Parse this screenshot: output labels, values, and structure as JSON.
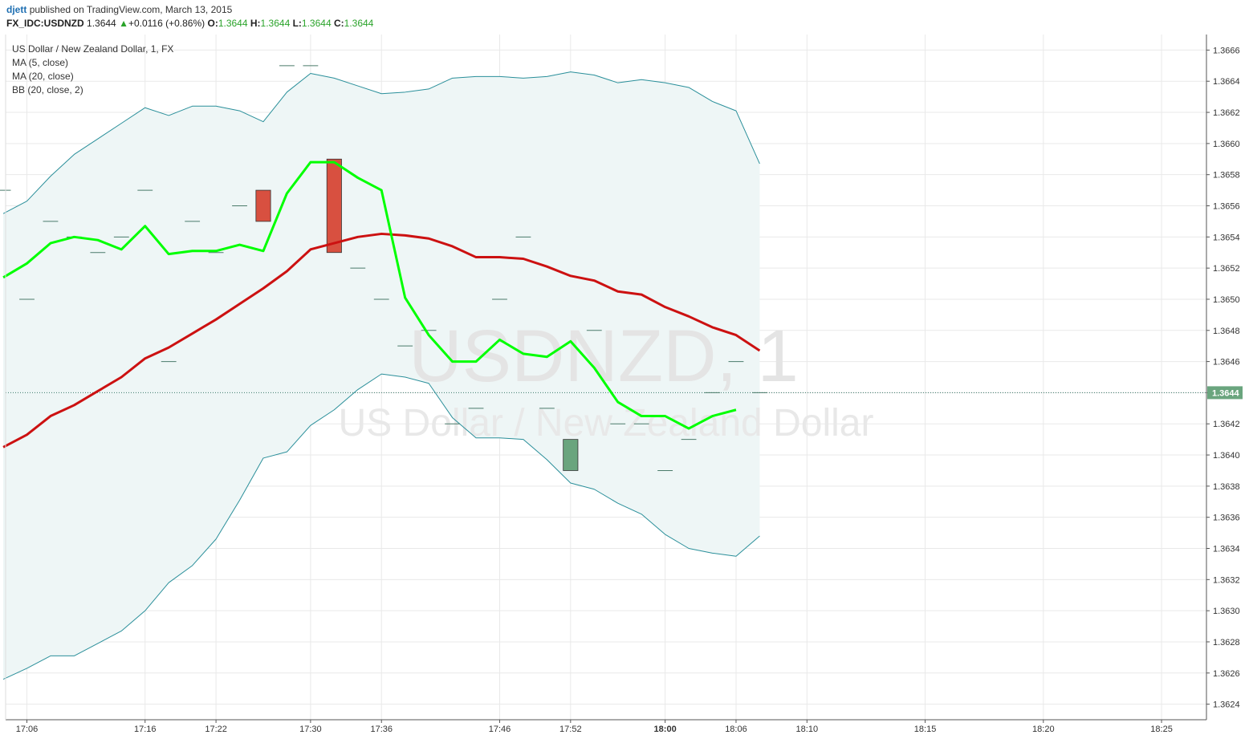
{
  "header": {
    "user": "djett",
    "published": "published on TradingView.com, March 13, 2015",
    "symbol": "FX_IDC:USDNZD",
    "last": "1.3644",
    "change_arrow": "▲",
    "change": "+0.0116 (+0.86%)",
    "o_label": "O:",
    "o_value": "1.3644",
    "h_label": "H:",
    "h_value": "1.3644",
    "l_label": "L:",
    "l_value": "1.3644",
    "c_label": "C:",
    "c_value": "1.3644"
  },
  "legend": {
    "title": "US Dollar / New Zealand Dollar, 1, FX",
    "ma5": "MA (5, close)",
    "ma20": "MA (20, close)",
    "bb": "BB (20, close, 2)"
  },
  "watermark": {
    "line1": "USDNZD, 1",
    "line2": "US Dollar / New Zealand Dollar"
  },
  "colors": {
    "ma5": "#00ff00",
    "ma20": "#cc1111",
    "bb": "#2a8f9a",
    "bb_fill": "#eef6f6",
    "up_candle": "#6aa57e",
    "down_candle": "#d85040",
    "grid": "#e9e9e9",
    "price_tag_bg": "#6aa57e"
  },
  "chart_data": {
    "type": "line",
    "price_tag": "1.3644",
    "current_price": 1.3644,
    "ylim": [
      1.3623,
      1.3667
    ],
    "y_ticks": [
      "1.3624",
      "1.3626",
      "1.3628",
      "1.3630",
      "1.3632",
      "1.3634",
      "1.3636",
      "1.3638",
      "1.3640",
      "1.3642",
      "1.3644",
      "1.3646",
      "1.3648",
      "1.3650",
      "1.3652",
      "1.3654",
      "1.3656",
      "1.3658",
      "1.3660",
      "1.3662",
      "1.3664",
      "1.3666"
    ],
    "x_ticks": [
      {
        "label": "17:06",
        "t": 0
      },
      {
        "label": "17:16",
        "t": 5
      },
      {
        "label": "17:22",
        "t": 8
      },
      {
        "label": "17:30",
        "t": 12
      },
      {
        "label": "17:36",
        "t": 15
      },
      {
        "label": "17:46",
        "t": 20
      },
      {
        "label": "17:52",
        "t": 23
      },
      {
        "label": "18:00",
        "t": 27,
        "bold": true
      },
      {
        "label": "18:06",
        "t": 30
      },
      {
        "label": "18:10",
        "t": 33
      },
      {
        "label": "18:15",
        "t": 38
      },
      {
        "label": "18:20",
        "t": 43
      },
      {
        "label": "18:25",
        "t": 48
      }
    ],
    "x_range": [
      -0.9,
      49.9
    ],
    "candles": [
      {
        "t": -1,
        "o": 1.3657,
        "c": 1.3657
      },
      {
        "t": 0,
        "o": 1.365,
        "c": 1.365
      },
      {
        "t": 1,
        "o": 1.3655,
        "c": 1.3655
      },
      {
        "t": 2,
        "o": 1.3654,
        "c": 1.3654
      },
      {
        "t": 3,
        "o": 1.3653,
        "c": 1.3653
      },
      {
        "t": 4,
        "o": 1.3654,
        "c": 1.3654
      },
      {
        "t": 5,
        "o": 1.3657,
        "c": 1.3657
      },
      {
        "t": 6,
        "o": 1.3646,
        "c": 1.3646
      },
      {
        "t": 7,
        "o": 1.3655,
        "c": 1.3655
      },
      {
        "t": 8,
        "o": 1.3653,
        "c": 1.3653
      },
      {
        "t": 9,
        "o": 1.3656,
        "c": 1.3656
      },
      {
        "t": 10,
        "o": 1.3657,
        "c": 1.3655
      },
      {
        "t": 11,
        "o": 1.3665,
        "c": 1.3665
      },
      {
        "t": 12,
        "o": 1.3665,
        "c": 1.3665
      },
      {
        "t": 13,
        "o": 1.3659,
        "c": 1.3653
      },
      {
        "t": 14,
        "o": 1.3652,
        "c": 1.3652
      },
      {
        "t": 15,
        "o": 1.365,
        "c": 1.365
      },
      {
        "t": 16,
        "o": 1.3647,
        "c": 1.3647
      },
      {
        "t": 17,
        "o": 1.3648,
        "c": 1.3648
      },
      {
        "t": 18,
        "o": 1.3642,
        "c": 1.3642
      },
      {
        "t": 19,
        "o": 1.3643,
        "c": 1.3643
      },
      {
        "t": 20,
        "o": 1.365,
        "c": 1.365
      },
      {
        "t": 21,
        "o": 1.3654,
        "c": 1.3654
      },
      {
        "t": 22,
        "o": 1.3643,
        "c": 1.3643
      },
      {
        "t": 23,
        "o": 1.3639,
        "c": 1.3641
      },
      {
        "t": 24,
        "o": 1.3648,
        "c": 1.3648
      },
      {
        "t": 25,
        "o": 1.3642,
        "c": 1.3642
      },
      {
        "t": 26,
        "o": 1.3642,
        "c": 1.3642
      },
      {
        "t": 27,
        "o": 1.3639,
        "c": 1.3639
      },
      {
        "t": 28,
        "o": 1.3641,
        "c": 1.3641
      },
      {
        "t": 29,
        "o": 1.3644,
        "c": 1.3644
      },
      {
        "t": 30,
        "o": 1.3646,
        "c": 1.3646
      },
      {
        "t": 31,
        "o": 1.3644,
        "c": 1.3644
      }
    ],
    "series": [
      {
        "name": "MA (5, close)",
        "t_start": -1,
        "values": [
          1.36514,
          1.36523,
          1.36536,
          1.3654,
          1.36538,
          1.36532,
          1.36547,
          1.36529,
          1.36531,
          1.36531,
          1.36535,
          1.36531,
          1.36568,
          1.36588,
          1.36588,
          1.36578,
          1.3657,
          1.36501,
          1.36477,
          1.3646,
          1.3646,
          1.36474,
          1.36465,
          1.36463,
          1.36473,
          1.36456,
          1.36434,
          1.36425,
          1.36425,
          1.36417,
          1.36425,
          1.36429
        ]
      },
      {
        "name": "MA (20, close)",
        "t_start": -1,
        "values": [
          1.36405,
          1.36413,
          1.36425,
          1.36432,
          1.36441,
          1.3645,
          1.36462,
          1.36469,
          1.36478,
          1.36487,
          1.36497,
          1.36507,
          1.36518,
          1.36532,
          1.36536,
          1.3654,
          1.36542,
          1.36541,
          1.36539,
          1.36534,
          1.36527,
          1.36527,
          1.36526,
          1.36521,
          1.36515,
          1.36512,
          1.36505,
          1.36503,
          1.36495,
          1.36489,
          1.36482,
          1.36477,
          1.36467
        ]
      },
      {
        "name": "BB upper",
        "t_start": -1,
        "values": [
          1.36555,
          1.36563,
          1.36579,
          1.36593,
          1.36603,
          1.36613,
          1.36623,
          1.36618,
          1.36624,
          1.36624,
          1.36621,
          1.36614,
          1.36633,
          1.36645,
          1.36642,
          1.36637,
          1.36632,
          1.36633,
          1.36635,
          1.36642,
          1.36643,
          1.36643,
          1.36642,
          1.36643,
          1.36646,
          1.36644,
          1.36639,
          1.36641,
          1.36639,
          1.36636,
          1.36627,
          1.36621,
          1.36587
        ]
      },
      {
        "name": "BB lower",
        "t_start": -1,
        "values": [
          1.36256,
          1.36263,
          1.36271,
          1.36271,
          1.36279,
          1.36287,
          1.363,
          1.36318,
          1.36329,
          1.36346,
          1.36371,
          1.36398,
          1.36402,
          1.36419,
          1.36429,
          1.36442,
          1.36452,
          1.3645,
          1.36446,
          1.36424,
          1.36411,
          1.36411,
          1.3641,
          1.36397,
          1.36382,
          1.36378,
          1.36369,
          1.36362,
          1.36349,
          1.3634,
          1.36337,
          1.36335,
          1.36348
        ]
      }
    ]
  }
}
